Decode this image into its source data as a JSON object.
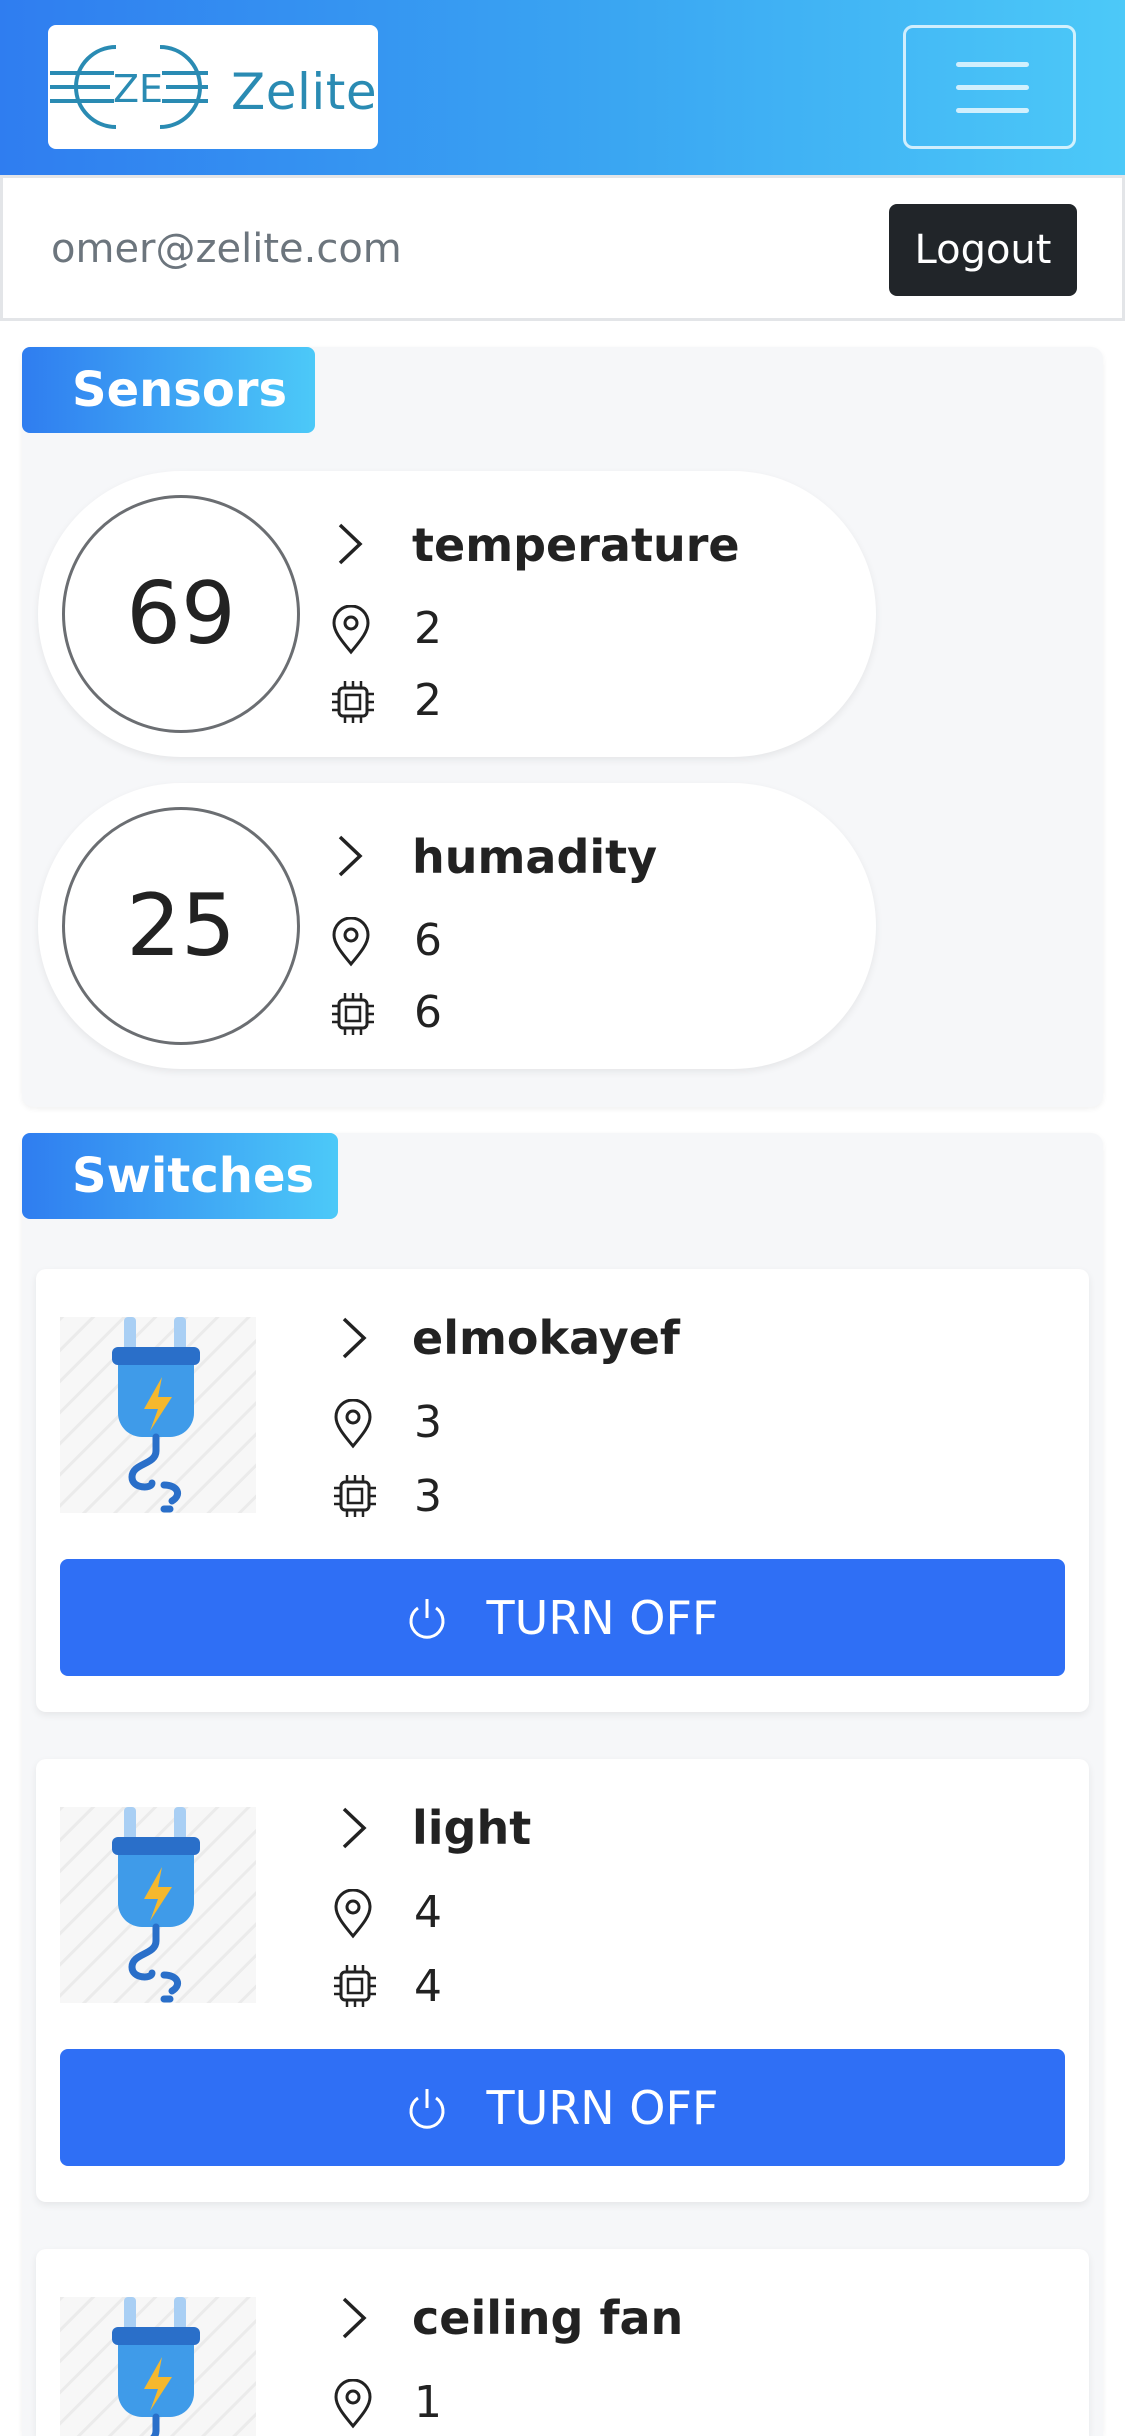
{
  "header": {
    "logo_text": "Zelite",
    "logo_mark_text": "ZE",
    "menu_icon": "hamburger-icon",
    "accent_gradient": [
      "#2f7df0",
      "#4cc9f8"
    ]
  },
  "user": {
    "email": "omer@zelite.com",
    "logout_label": "Logout"
  },
  "sensors": {
    "title": "Sensors",
    "items": [
      {
        "value": "69",
        "name": "temperature",
        "location": "2",
        "device": "2"
      },
      {
        "value": "25",
        "name": "humadity",
        "location": "6",
        "device": "6"
      }
    ]
  },
  "switches": {
    "title": "Switches",
    "items": [
      {
        "name": "elmokayef",
        "location": "3",
        "device": "3",
        "button_label": "TURN OFF"
      },
      {
        "name": "light",
        "location": "4",
        "device": "4",
        "button_label": "TURN OFF"
      },
      {
        "name": "ceiling fan",
        "location": "1",
        "device": "",
        "button_label": ""
      }
    ]
  },
  "icons": {
    "chevron": "chevron-right-icon",
    "location": "map-pin-icon",
    "device": "chip-icon",
    "power": "power-icon",
    "plug": "plug-icon"
  },
  "colors": {
    "button_blue": "#2f6ff5",
    "logout_dark": "#212529",
    "section_bg": "#f6f7f9"
  }
}
